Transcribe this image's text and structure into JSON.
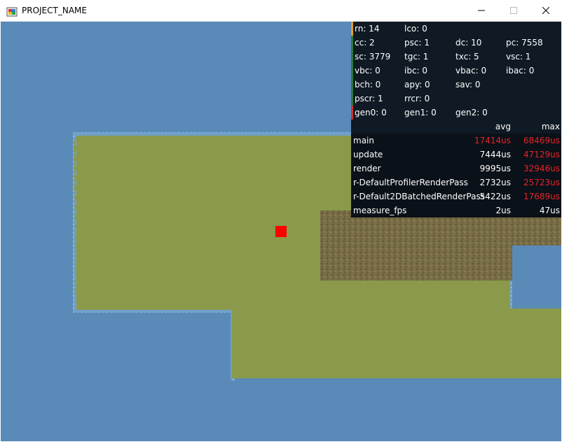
{
  "window": {
    "title": "PROJECT_NAME",
    "minimize_icon": "minimize-icon",
    "maximize_icon": "maximize-icon",
    "close_icon": "close-icon"
  },
  "game": {
    "water_color": "#5a8ab8",
    "grass_color": "#8a9a4a",
    "dirt_color": "#7a6e48",
    "player_color": "#ff0000"
  },
  "profiler": {
    "stats": [
      [
        {
          "text": "rn: 14"
        },
        {
          "text": "lco: 0"
        }
      ],
      [
        {
          "text": "cc: 2"
        },
        {
          "text": "psc: 1"
        },
        {
          "text": "dc: 10"
        },
        {
          "text": "pc: 7558"
        }
      ],
      [
        {
          "text": "sc: 3779"
        },
        {
          "text": "tgc: 1"
        },
        {
          "text": "txc: 5"
        },
        {
          "text": "vsc: 1"
        }
      ],
      [
        {
          "text": "vbc: 0"
        },
        {
          "text": "ibc: 0"
        },
        {
          "text": "vbac: 0"
        },
        {
          "text": "ibac: 0"
        }
      ],
      [
        {
          "text": "bch: 0"
        },
        {
          "text": "apy: 0"
        },
        {
          "text": "sav: 0"
        }
      ],
      [
        {
          "text": "pscr: 1"
        },
        {
          "text": "rrcr: 0"
        }
      ],
      [
        {
          "text": "gen0: 0"
        },
        {
          "text": "gen1: 0"
        },
        {
          "text": "gen2: 0"
        }
      ]
    ],
    "row_bar_colors": [
      "#e0a020",
      "#2a7a3a",
      "#2a7a3a",
      "#2a7a3a",
      "#2a7a3a",
      "#2a7a3a",
      "#d03030"
    ],
    "timings_header": {
      "avg": "avg",
      "max": "max"
    },
    "timings": [
      {
        "name": "main",
        "avg": "17414us",
        "max": "68469us",
        "avg_red": true,
        "max_red": true
      },
      {
        "name": "update",
        "avg": "7444us",
        "max": "47129us",
        "avg_red": false,
        "max_red": true
      },
      {
        "name": "render",
        "avg": "9995us",
        "max": "32946us",
        "avg_red": false,
        "max_red": true
      },
      {
        "name": "r-DefaultProfilerRenderPass",
        "avg": "2732us",
        "max": "25723us",
        "avg_red": false,
        "max_red": true
      },
      {
        "name": "r-Default2DBatchedRenderPass",
        "avg": "5422us",
        "max": "17689us",
        "avg_red": false,
        "max_red": true
      },
      {
        "name": "measure_fps",
        "avg": "2us",
        "max": "47us",
        "avg_red": false,
        "max_red": false
      }
    ]
  }
}
